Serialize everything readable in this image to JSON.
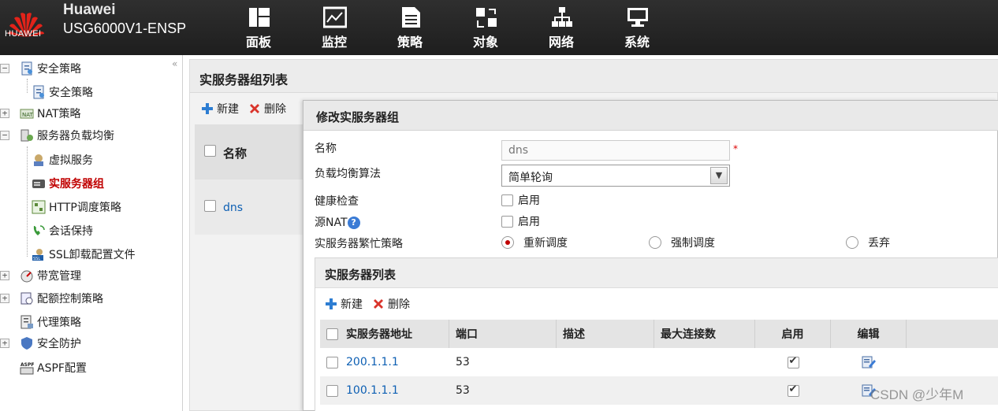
{
  "header": {
    "logo_text": "HUAWEI",
    "brand": "Huawei",
    "model": "USG6000V1-ENSP",
    "nav": [
      {
        "label": "面板",
        "icon": "dashboard-icon"
      },
      {
        "label": "监控",
        "icon": "monitor-chart-icon"
      },
      {
        "label": "策略",
        "icon": "document-icon"
      },
      {
        "label": "对象",
        "icon": "object-icon"
      },
      {
        "label": "网络",
        "icon": "network-icon"
      },
      {
        "label": "系统",
        "icon": "system-computer-icon"
      }
    ]
  },
  "sidebar": {
    "items": [
      {
        "label": "安全策略",
        "icon": "security-policy-icon",
        "expander": "−"
      },
      {
        "label": "安全策略",
        "icon": "security-policy-icon"
      },
      {
        "label": "NAT策略",
        "icon": "nat-icon",
        "expander": "+"
      },
      {
        "label": "服务器负载均衡",
        "icon": "slb-icon",
        "expander": "−"
      },
      {
        "label": "虚拟服务",
        "icon": "virtual-service-icon"
      },
      {
        "label": "实服务器组",
        "icon": "server-group-icon"
      },
      {
        "label": "HTTP调度策略",
        "icon": "http-schedule-icon"
      },
      {
        "label": "会话保持",
        "icon": "session-keep-icon"
      },
      {
        "label": "SSL卸载配置文件",
        "icon": "ssl-icon"
      },
      {
        "label": "带宽管理",
        "icon": "bandwidth-icon",
        "expander": "+"
      },
      {
        "label": "配额控制策略",
        "icon": "quota-icon",
        "expander": "+"
      },
      {
        "label": "代理策略",
        "icon": "proxy-icon"
      },
      {
        "label": "安全防护",
        "icon": "shield-icon",
        "expander": "+"
      },
      {
        "label": "ASPF配置",
        "icon": "aspf-icon"
      }
    ],
    "selected_index": 5
  },
  "main": {
    "title": "实服务器组列表",
    "new_label": "新建",
    "delete_label": "删除",
    "column_name": "名称",
    "rows": [
      "dns"
    ]
  },
  "dialog": {
    "title": "修改实服务器组",
    "name_label": "名称",
    "name_value": "dns",
    "required_mark": "*",
    "algorithm_label": "负载均衡算法",
    "algorithm_value": "简单轮询",
    "health_label": "健康检查",
    "health_option": "启用",
    "src_nat_label": "源NAT",
    "src_nat_option": "启用",
    "busy_label": "实服务器繁忙策略",
    "busy_options": [
      "重新调度",
      "强制调度",
      "丢弃"
    ],
    "busy_selected": "重新调度",
    "servers": {
      "title": "实服务器列表",
      "new_label": "新建",
      "delete_label": "删除",
      "columns": [
        "实服务器地址",
        "端口",
        "描述",
        "最大连接数",
        "启用",
        "编辑"
      ],
      "rows": [
        {
          "address": "200.1.1.1",
          "port": "53",
          "desc": "",
          "max_conn": "",
          "enabled": true
        },
        {
          "address": "100.1.1.1",
          "port": "53",
          "desc": "",
          "max_conn": "",
          "enabled": true
        }
      ]
    }
  },
  "watermark": "CSDN @少年M",
  "colors": {
    "header_bg": "#2a2a2a",
    "selected_text": "#c00000",
    "link": "#0d5fb3",
    "add_icon": "#2d7dd2",
    "delete_icon": "#d9342b"
  }
}
